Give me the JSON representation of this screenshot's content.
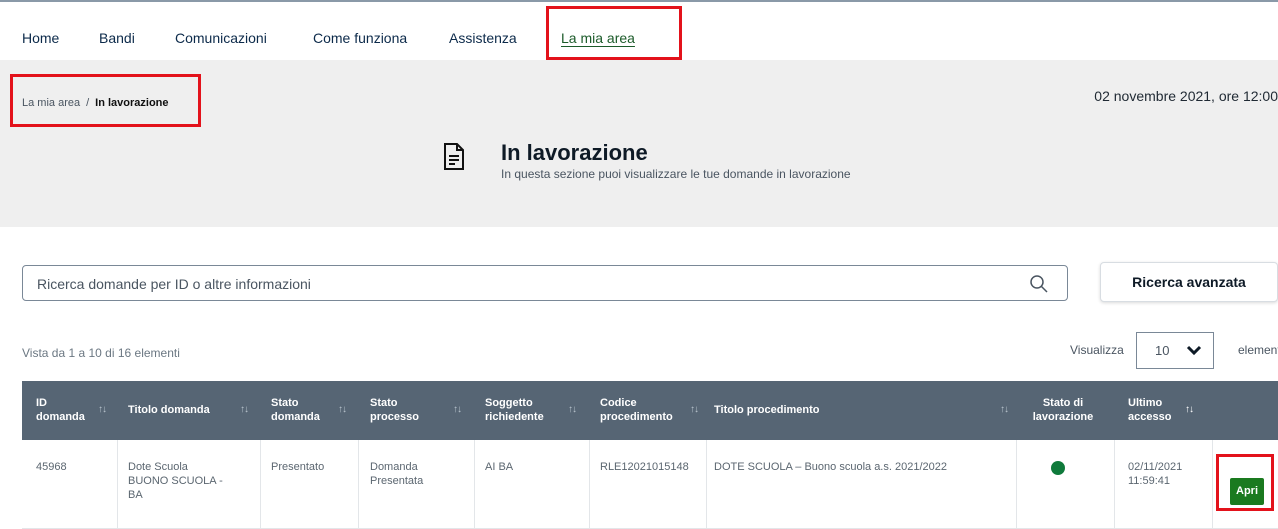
{
  "nav": {
    "items": [
      "Home",
      "Bandi",
      "Comunicazioni",
      "Come funziona",
      "Assistenza",
      "La mia area"
    ],
    "active": "La mia area"
  },
  "breadcrumb": {
    "parent": "La mia area",
    "separator": "/",
    "current": "In lavorazione"
  },
  "datestamp": "02 novembre 2021, ore 12:00",
  "hero": {
    "title": "In lavorazione",
    "subtitle": "In questa sezione puoi visualizzare le tue domande in lavorazione"
  },
  "search": {
    "placeholder": "Ricerca domande per ID o altre informazioni",
    "advanced_label": "Ricerca avanzata"
  },
  "listing": {
    "count_text": "Vista da 1 a 10 di 16 elementi",
    "show_label": "Visualizza",
    "page_size": "10",
    "elements_label": "elementi"
  },
  "table": {
    "columns": [
      "ID domanda",
      "Titolo domanda",
      "Stato domanda",
      "Stato processo",
      "Soggetto richiedente",
      "Codice procedimento",
      "Titolo procedimento",
      "Stato di lavorazione",
      "Ultimo accesso"
    ],
    "rows": [
      {
        "id": "45968",
        "titolo": "Dote Scuola BUONO SCUOLA - BA",
        "stato_domanda": "Presentato",
        "stato_processo": "Domanda Presentata",
        "soggetto": "AI BA",
        "codice": "RLE12021015148",
        "titolo_procedimento": "DOTE SCUOLA – Buono scuola a.s. 2021/2022",
        "stato_lavorazione_color": "#0f7a3b",
        "ultimo_accesso": "02/11/2021 11:59:41",
        "action": "Apri"
      }
    ]
  },
  "colors": {
    "highlight": "#e3121b",
    "header_bg": "#566574",
    "action_bg": "#1a7a1f",
    "status_ok": "#0f7a3b"
  }
}
